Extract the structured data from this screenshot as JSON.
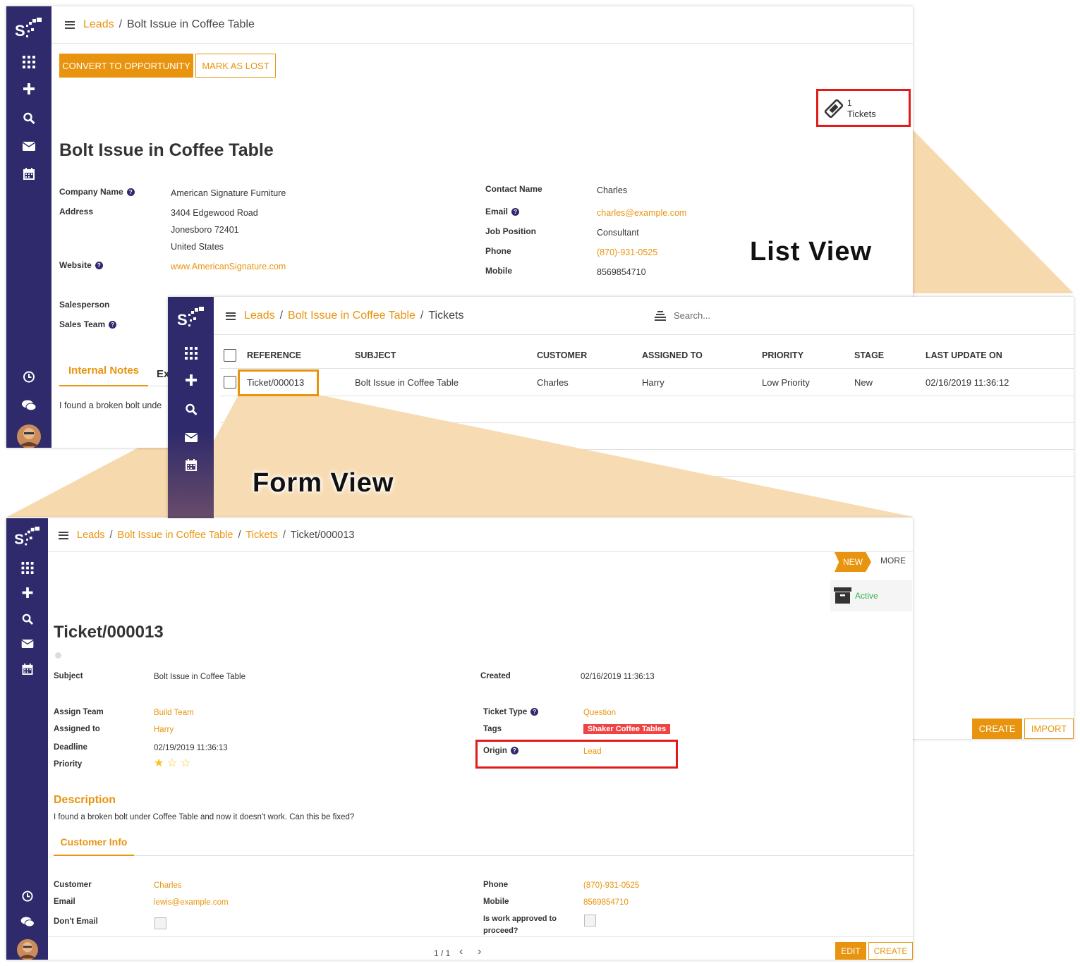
{
  "lead": {
    "breadcrumb": {
      "root": "Leads",
      "current": "Bolt Issue in Coffee Table"
    },
    "buttons": {
      "convert": "CONVERT TO OPPORTUNITY",
      "lost": "MARK AS LOST"
    },
    "smart_button": {
      "count": "1",
      "label": "Tickets"
    },
    "title": "Bolt Issue in Coffee Table",
    "fields": {
      "company_label": "Company Name",
      "company": "American Signature Furniture",
      "address_label": "Address",
      "address1": "3404 Edgewood Road",
      "address2": "Jonesboro  72401",
      "address3": "United States",
      "website_label": "Website",
      "website": "www.AmericanSignature.com",
      "salesperson_label": "Salesperson",
      "salesteam_label": "Sales Team",
      "contact_label": "Contact Name",
      "contact": "Charles",
      "email_label": "Email",
      "email": "charles@example.com",
      "job_label": "Job Position",
      "job": "Consultant",
      "phone_label": "Phone",
      "phone": "(870)-931-0525",
      "mobile_label": "Mobile",
      "mobile": "8569854710"
    },
    "tabs": {
      "notes": "Internal Notes",
      "ex": "Ex"
    },
    "notes_text": "I found a  broken bolt unde"
  },
  "labels": {
    "list_view": "List View",
    "form_view": "Form View"
  },
  "list": {
    "breadcrumb": {
      "root": "Leads",
      "mid": "Bolt Issue in Coffee Table",
      "current": "Tickets"
    },
    "search_placeholder": "Search...",
    "columns": [
      "REFERENCE",
      "SUBJECT",
      "CUSTOMER",
      "ASSIGNED TO",
      "PRIORITY",
      "STAGE",
      "LAST UPDATE ON"
    ],
    "row": {
      "reference": "Ticket/000013",
      "subject": "Bolt Issue in Coffee Table",
      "customer": "Charles",
      "assigned": "Harry",
      "priority": "Low Priority",
      "stage": "New",
      "updated": "02/16/2019 11:36:12"
    },
    "buttons": {
      "create": "CREATE",
      "import": "IMPORT"
    }
  },
  "form": {
    "breadcrumb": {
      "root": "Leads",
      "mid": "Bolt Issue in Coffee Table",
      "mid2": "Tickets",
      "current": "Ticket/000013"
    },
    "stage": {
      "new": "NEW",
      "more": "MORE"
    },
    "active": "Active",
    "title": "Ticket/000013",
    "fields": {
      "subject_label": "Subject",
      "subject": "Bolt Issue in Coffee Table",
      "created_label": "Created",
      "created": "02/16/2019 11:36:13",
      "team_label": "Assign Team",
      "team": "Build Team",
      "assigned_label": "Assigned to",
      "assigned": "Harry",
      "deadline_label": "Deadline",
      "deadline": "02/19/2019 11:36:13",
      "priority_label": "Priority",
      "type_label": "Ticket Type",
      "type": "Question",
      "tags_label": "Tags",
      "tag": "Shaker Coffee Tables",
      "origin_label": "Origin",
      "origin": "Lead"
    },
    "priority_stars": {
      "filled": 1,
      "total": 3
    },
    "description_title": "Description",
    "description": "I found a  broken bolt under Coffee Table and now it doesn't work. Can this be fixed?",
    "tab": "Customer Info",
    "customer": {
      "customer_label": "Customer",
      "customer": "Charles",
      "email_label": "Email",
      "email": "lewis@example.com",
      "dont_email_label": "Don't Email",
      "phone_label": "Phone",
      "phone": "(870)-931-0525",
      "mobile_label": "Mobile",
      "mobile": "8569854710",
      "approved_label_1": "Is work approved to",
      "approved_label_2": "proceed?"
    },
    "pager": "1 / 1",
    "buttons": {
      "edit": "EDIT",
      "create": "CREATE"
    }
  },
  "colors": {
    "accent": "#e8940e",
    "sidebar": "#2e2a6b",
    "highlight": "#e21a1a",
    "callout": "#f6d9ad",
    "tag": "#ef4444",
    "active": "#2db34a"
  }
}
